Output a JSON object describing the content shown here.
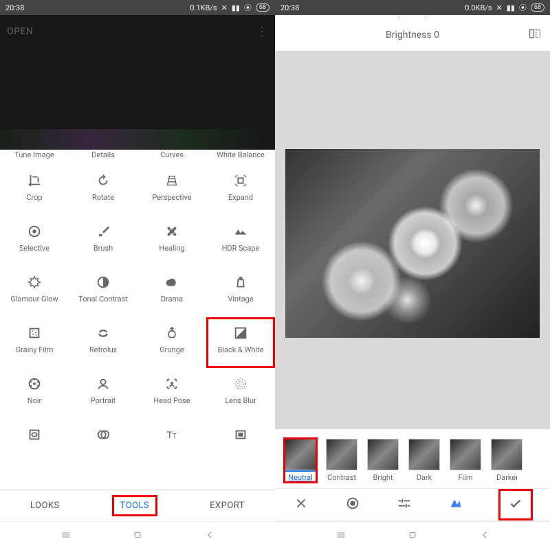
{
  "status": {
    "time": "20:38",
    "speed_left": "0.1KB/s",
    "speed_right": "0.0KB/s",
    "battery": "68"
  },
  "left": {
    "open": "OPEN",
    "tools_row1": [
      "Tune Image",
      "Details",
      "Curves",
      "White Balance"
    ],
    "tools": [
      {
        "label": "Crop",
        "icon": "crop"
      },
      {
        "label": "Rotate",
        "icon": "rotate"
      },
      {
        "label": "Perspective",
        "icon": "perspective"
      },
      {
        "label": "Expand",
        "icon": "expand"
      },
      {
        "label": "Selective",
        "icon": "selective"
      },
      {
        "label": "Brush",
        "icon": "brush"
      },
      {
        "label": "Healing",
        "icon": "healing"
      },
      {
        "label": "HDR Scape",
        "icon": "hdr"
      },
      {
        "label": "Glamour Glow",
        "icon": "glow"
      },
      {
        "label": "Tonal Contrast",
        "icon": "tonal"
      },
      {
        "label": "Drama",
        "icon": "drama"
      },
      {
        "label": "Vintage",
        "icon": "vintage"
      },
      {
        "label": "Grainy Film",
        "icon": "grainy"
      },
      {
        "label": "Retrolux",
        "icon": "retrolux"
      },
      {
        "label": "Grunge",
        "icon": "grunge"
      },
      {
        "label": "Black & White",
        "icon": "bw",
        "hl": true
      },
      {
        "label": "Noir",
        "icon": "noir"
      },
      {
        "label": "Portrait",
        "icon": "portrait"
      },
      {
        "label": "Head Pose",
        "icon": "headpose"
      },
      {
        "label": "Lens Blur",
        "icon": "lensblur"
      }
    ],
    "tools_last": [
      {
        "icon": "vignette"
      },
      {
        "icon": "double"
      },
      {
        "icon": "text"
      },
      {
        "icon": "frame"
      }
    ],
    "tabs": {
      "looks": "LOOKS",
      "tools": "TOOLS",
      "export": "EXPORT"
    }
  },
  "right": {
    "brightness_label": "Brightness 0",
    "filters": [
      {
        "label": "Neutral",
        "sel": true
      },
      {
        "label": "Contrast"
      },
      {
        "label": "Bright"
      },
      {
        "label": "Dark"
      },
      {
        "label": "Film"
      },
      {
        "label": "Darker"
      }
    ]
  }
}
